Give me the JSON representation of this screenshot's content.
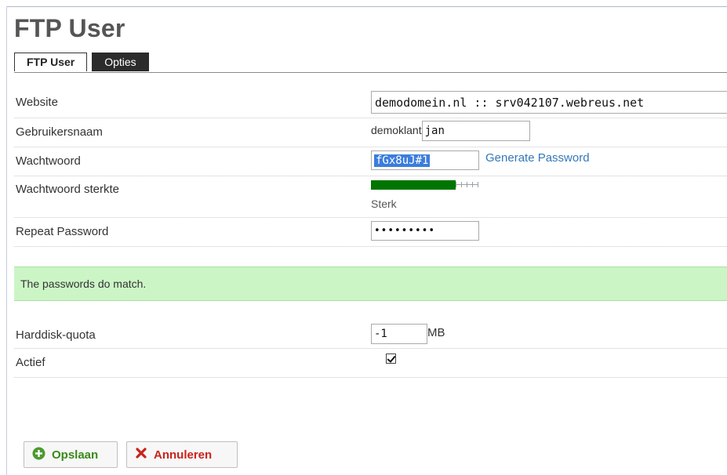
{
  "page": {
    "title": "FTP User"
  },
  "tabs": [
    {
      "label": "FTP User",
      "active": true
    },
    {
      "label": "Opties",
      "active": false
    }
  ],
  "form": {
    "website": {
      "label": "Website",
      "value": "demodomein.nl :: srv042107.webreus.net"
    },
    "username": {
      "label": "Gebruikersnaam",
      "prefix": "demoklant",
      "value": "jan"
    },
    "password": {
      "label": "Wachtwoord",
      "value": "fGx8uJ#1",
      "generate_label": "Generate Password"
    },
    "strength": {
      "label": "Wachtwoord sterkte",
      "text": "Sterk",
      "level_fraction": 0.8
    },
    "repeat": {
      "label": "Repeat Password",
      "value": "•••••••••"
    },
    "match_message": "The passwords do match.",
    "quota": {
      "label": "Harddisk-quota",
      "value": "-1",
      "unit": "MB"
    },
    "active": {
      "label": "Actief",
      "checked": true
    }
  },
  "buttons": {
    "save": "Opslaan",
    "cancel": "Annuleren"
  },
  "colors": {
    "strength_bar": "#007500",
    "match_background": "#ccf5c6",
    "link": "#3478b8",
    "save_text": "#3a8a1c",
    "cancel_text": "#c8231b"
  }
}
